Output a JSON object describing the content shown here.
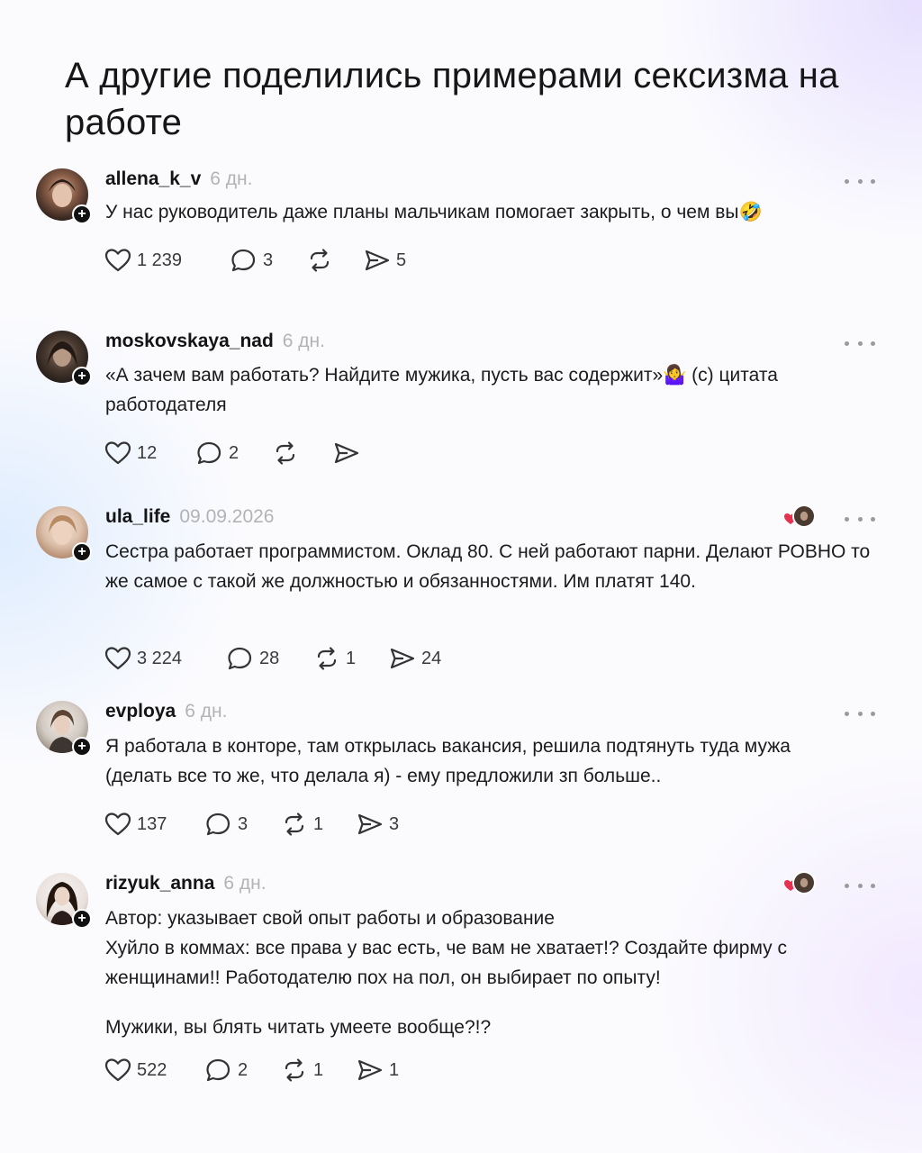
{
  "title": "А другие поделились примерами сексизма на работе",
  "posts": [
    {
      "username": "allena_k_v",
      "time": "6 дн.",
      "text": [
        "У нас руководитель даже планы мальчикам помогает закрыть, о чем вы🤣"
      ],
      "likes": "1 239",
      "comments": "3",
      "reposts": "",
      "shares": "5",
      "avatar_colors": [
        "#3a2a22",
        "#c9a08a"
      ]
    },
    {
      "username": "moskovskaya_nad",
      "time": "6 дн.",
      "text": [
        "«А зачем вам работать? Найдите мужика, пусть вас содержит»🤷‍♀️ (с) цитата работодателя"
      ],
      "likes": "12",
      "comments": "2",
      "reposts": "",
      "shares": "",
      "avatar_colors": [
        "#2b2622",
        "#6b5a4e"
      ]
    },
    {
      "username": "ula_life",
      "time": "09.09.2026",
      "text": [
        "Сестра работает программистом. Оклад 80. С ней работают парни. Делают РОВНО то же самое с такой же должностью и обязанностями. Им платят 140."
      ],
      "likes": "3 224",
      "comments": "28",
      "reposts": "1",
      "shares": "24",
      "avatar_colors": [
        "#e8d6c8",
        "#c49a7a"
      ]
    },
    {
      "username": "evploya",
      "time": "6 дн.",
      "text": [
        "Я работала в конторе, там открылась вакансия, решила подтянуть туда мужа (делать все то же, что делала я) - ему предложили зп больше.."
      ],
      "likes": "137",
      "comments": "3",
      "reposts": "1",
      "shares": "3",
      "avatar_colors": [
        "#d9d4cf",
        "#6d5a4a"
      ]
    },
    {
      "username": "rizyuk_anna",
      "time": "6 дн.",
      "text": [
        "Автор: указывает свой опыт работы и образование",
        "Хуйло в коммах: все права у вас есть, че вам не хватает!? Создайте фирму с женщинами!! Работодателю пох на пол, он выбирает по опыту!",
        "Мужики, вы блять читать умеете вообще?!?"
      ],
      "likes": "522",
      "comments": "2",
      "reposts": "1",
      "shares": "1",
      "avatar_colors": [
        "#efe8e4",
        "#2a1c18"
      ]
    }
  ],
  "colors": {
    "text": "#1b1b1b",
    "muted": "#b3b3b3",
    "icon": "#3a3a3a",
    "heart_red": "#e8304f"
  }
}
